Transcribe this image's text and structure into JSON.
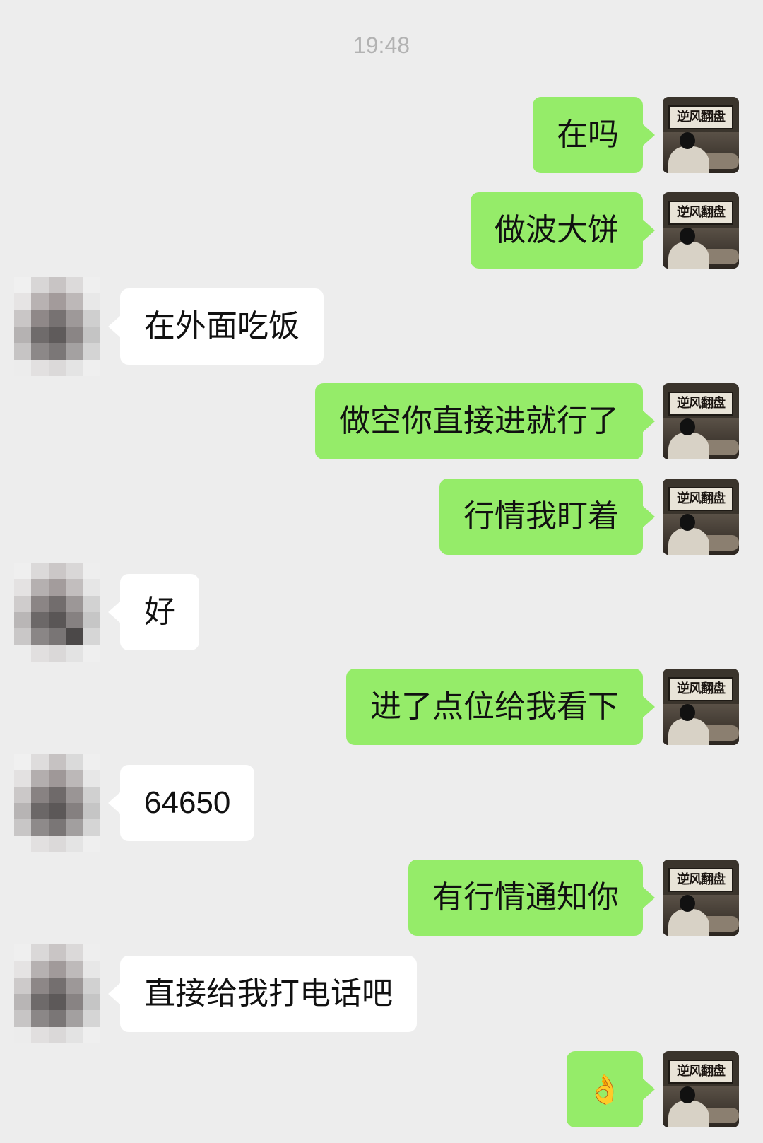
{
  "chat": {
    "timestamp": "19:48",
    "me_avatar_text": "逆风翻盘",
    "messages": [
      {
        "from": "me",
        "text": "在吗"
      },
      {
        "from": "me",
        "text": "做波大饼"
      },
      {
        "from": "other",
        "text": "在外面吃饭"
      },
      {
        "from": "me",
        "text": "做空你直接进就行了"
      },
      {
        "from": "me",
        "text": "行情我盯着"
      },
      {
        "from": "other",
        "text": "好"
      },
      {
        "from": "me",
        "text": "进了点位给我看下"
      },
      {
        "from": "other",
        "text": "64650"
      },
      {
        "from": "me",
        "text": "有行情通知你"
      },
      {
        "from": "other",
        "text": "直接给我打电话吧"
      },
      {
        "from": "me",
        "text": "👌"
      }
    ]
  },
  "colors": {
    "background": "#ededed",
    "my_bubble": "#95ec69",
    "other_bubble": "#ffffff",
    "timestamp_text": "#b2b2b2"
  },
  "icons": {
    "other_avatar": "pixelated-avatar",
    "my_avatar": "calligraphy-frame-avatar",
    "last_message": "ok-hand-emoji"
  }
}
